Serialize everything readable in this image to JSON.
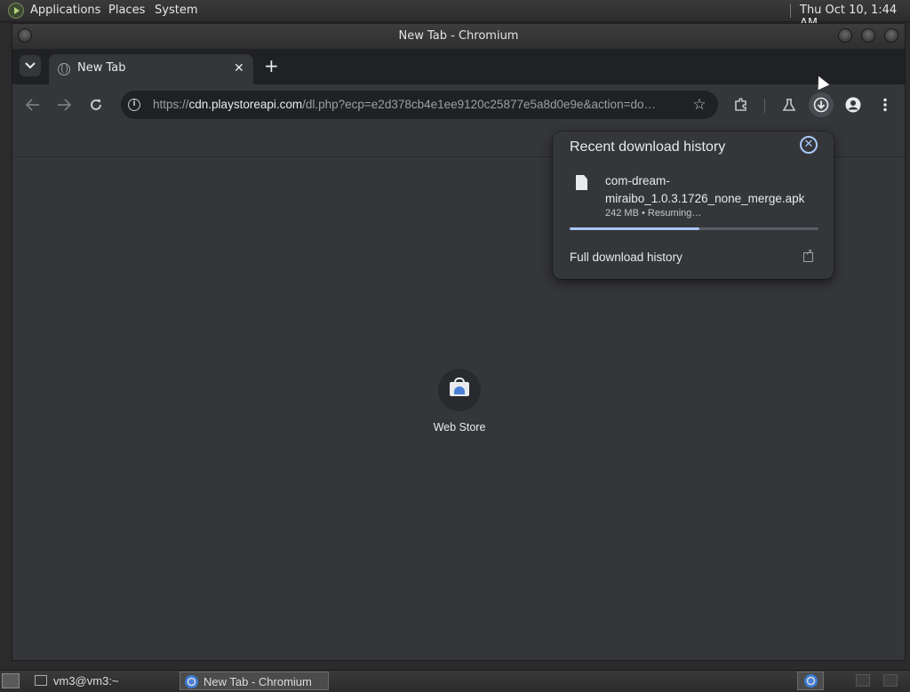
{
  "top_panel": {
    "menu": [
      "Applications",
      "Places",
      "System"
    ],
    "clock": "Thu Oct 10,  1:44 AM"
  },
  "window": {
    "title": "New Tab - Chromium"
  },
  "tabs": [
    {
      "title": "New Tab",
      "active": true
    }
  ],
  "toolbar": {
    "url_prefix": "https://",
    "url_host": "cdn.playstoreapi.com",
    "url_rest": "/dl.php?ecp=e2d378cb4e1ee9120c25877e5a8d0e9e&action=do…"
  },
  "ntp": {
    "shortcut_label": "Web Store"
  },
  "download_bubble": {
    "title": "Recent download history",
    "file_name": "com-dream-miraibo_1.0.3.1726_none_merge.apk",
    "file_status": "242 MB • Resuming…",
    "progress_fraction": 0.52,
    "full_history_label": "Full download history"
  },
  "taskbar": {
    "tasks": [
      {
        "label": "vm3@vm3:~"
      },
      {
        "label": "New Tab - Chromium"
      }
    ]
  },
  "colors": {
    "accent": "#a8c7fa",
    "surface": "#35363a",
    "frame": "#202124"
  }
}
